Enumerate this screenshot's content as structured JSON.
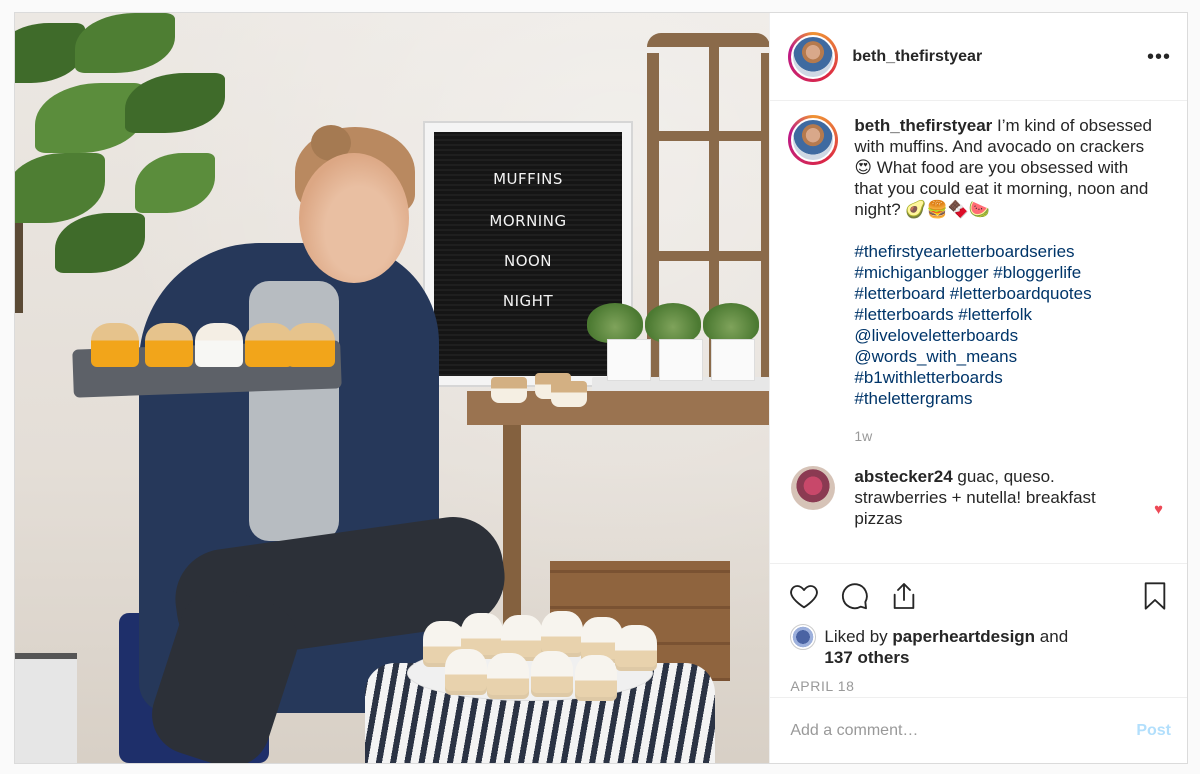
{
  "post": {
    "username": "beth_thefirstyear",
    "more_label": "•••",
    "photo": {
      "letterboard_lines": [
        "MUFFINS",
        "MORNING",
        "NOON",
        "NIGHT"
      ]
    },
    "caption": {
      "username": "beth_thefirstyear",
      "text": " I’m kind of obsessed with muffins. And avocado on crackers 😍  What food are you obsessed with that you could eat it morning, noon and night? 🥑🍔🍫🍉",
      "hashtags": [
        "#thefirstyearletterboardseries",
        "#michiganblogger #bloggerlife",
        "#letterboard #letterboardquotes",
        "#letterboards #letterfolk",
        "@liveloveletterboards",
        "@words_with_means",
        "#b1withletterboards",
        "#thelettergrams"
      ],
      "time": "1w"
    },
    "comments": [
      {
        "username": "abstecker24",
        "text": " guac, queso. strawberries + nutella! breakfast pizzas"
      }
    ],
    "likes": {
      "prefix": "Liked by ",
      "user": "paperheartdesign",
      "middle": " and",
      "others": "137 others"
    },
    "date": "APRIL 18",
    "add_comment_placeholder": "Add a comment…",
    "post_button": "Post",
    "colors": {
      "link": "#003569",
      "like_heart": "#ed4956",
      "post_disabled": "#b2dffc"
    }
  }
}
